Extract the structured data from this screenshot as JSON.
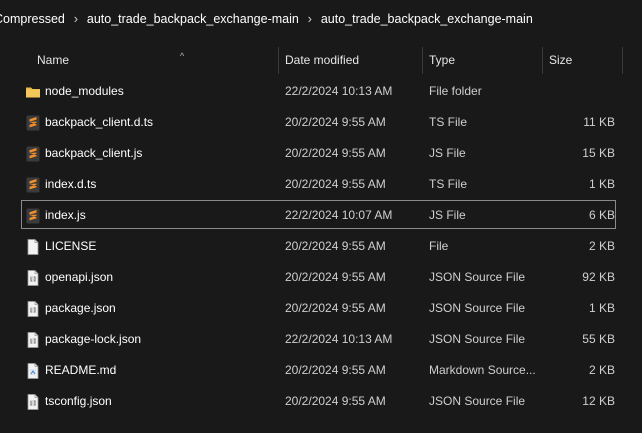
{
  "breadcrumb": {
    "items": [
      "Compressed",
      "auto_trade_backpack_exchange-main",
      "auto_trade_backpack_exchange-main"
    ],
    "separator": "›"
  },
  "columns": {
    "name": "Name",
    "date": "Date modified",
    "type": "Type",
    "size": "Size",
    "sort_indicator": "^"
  },
  "files": [
    {
      "icon": "folder-icon",
      "name": "node_modules",
      "date": "22/2/2024 10:13 AM",
      "type": "File folder",
      "size": ""
    },
    {
      "icon": "sublime-text-icon",
      "name": "backpack_client.d.ts",
      "date": "20/2/2024 9:55 AM",
      "type": "TS File",
      "size": "11 KB"
    },
    {
      "icon": "sublime-text-icon",
      "name": "backpack_client.js",
      "date": "20/2/2024 9:55 AM",
      "type": "JS File",
      "size": "15 KB"
    },
    {
      "icon": "sublime-text-icon",
      "name": "index.d.ts",
      "date": "20/2/2024 9:55 AM",
      "type": "TS File",
      "size": "1 KB"
    },
    {
      "icon": "sublime-text-icon",
      "name": "index.js",
      "date": "22/2/2024 10:07 AM",
      "type": "JS File",
      "size": "6 KB",
      "selected": true
    },
    {
      "icon": "blank-file-icon",
      "name": "LICENSE",
      "date": "20/2/2024 9:55 AM",
      "type": "File",
      "size": "2 KB"
    },
    {
      "icon": "json-file-icon",
      "name": "openapi.json",
      "date": "20/2/2024 9:55 AM",
      "type": "JSON Source File",
      "size": "92 KB"
    },
    {
      "icon": "json-file-icon",
      "name": "package.json",
      "date": "20/2/2024 9:55 AM",
      "type": "JSON Source File",
      "size": "1 KB"
    },
    {
      "icon": "json-file-icon",
      "name": "package-lock.json",
      "date": "22/2/2024 10:13 AM",
      "type": "JSON Source File",
      "size": "55 KB"
    },
    {
      "icon": "markdown-file-icon",
      "name": "README.md",
      "date": "20/2/2024 9:55 AM",
      "type": "Markdown Source...",
      "size": "2 KB"
    },
    {
      "icon": "json-file-icon",
      "name": "tsconfig.json",
      "date": "20/2/2024 9:55 AM",
      "type": "JSON Source File",
      "size": "12 KB"
    }
  ],
  "colors": {
    "background": "#191919",
    "folder": "#e8b84a",
    "sublime": "#f2902b",
    "selection_border": "#8a8a8a"
  }
}
